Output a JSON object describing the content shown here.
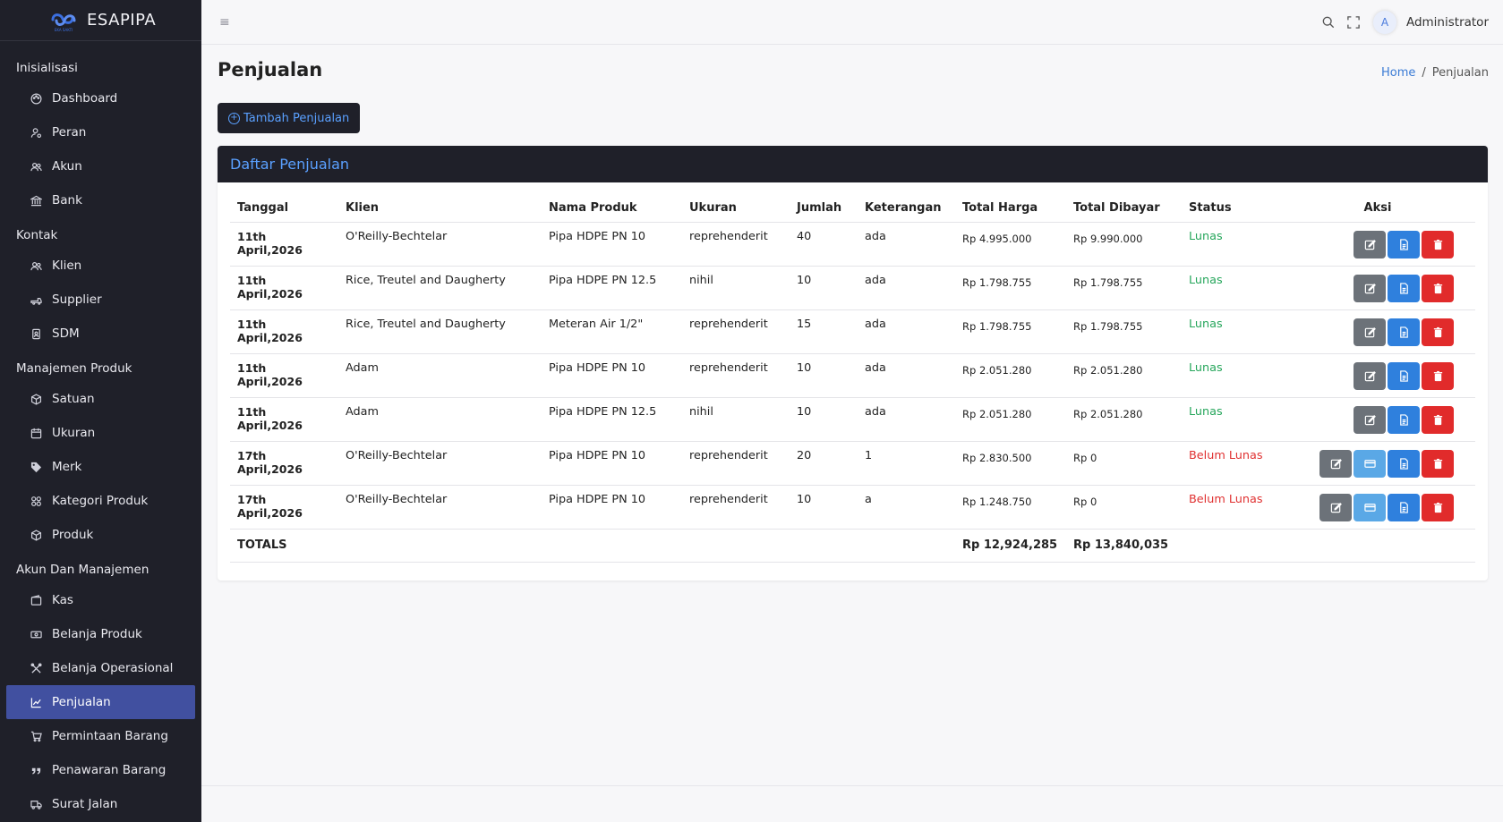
{
  "brand": {
    "name": "ESAPIPA",
    "logo_text": "EKA SAKTI"
  },
  "sidebar": {
    "sections": [
      {
        "title": "Inisialisasi",
        "items": [
          {
            "label": "Dashboard",
            "icon": "palette-icon"
          },
          {
            "label": "Peran",
            "icon": "user-role-icon"
          },
          {
            "label": "Akun",
            "icon": "users-icon"
          },
          {
            "label": "Bank",
            "icon": "bank-icon"
          }
        ]
      },
      {
        "title": "Kontak",
        "items": [
          {
            "label": "Klien",
            "icon": "users-icon"
          },
          {
            "label": "Supplier",
            "icon": "truck-arrow-icon"
          },
          {
            "label": "SDM",
            "icon": "id-badge-icon"
          }
        ]
      },
      {
        "title": "Manajemen Produk",
        "items": [
          {
            "label": "Satuan",
            "icon": "box-icon"
          },
          {
            "label": "Ukuran",
            "icon": "calendar-icon"
          },
          {
            "label": "Merk",
            "icon": "tag-icon"
          },
          {
            "label": "Kategori Produk",
            "icon": "categories-icon"
          },
          {
            "label": "Produk",
            "icon": "box-icon"
          }
        ]
      },
      {
        "title": "Akun Dan Manajemen",
        "items": [
          {
            "label": "Kas",
            "icon": "wallet-icon"
          },
          {
            "label": "Belanja Produk",
            "icon": "cash-icon"
          },
          {
            "label": "Belanja Operasional",
            "icon": "tools-icon"
          },
          {
            "label": "Penjualan",
            "icon": "chart-line-icon",
            "active": true
          },
          {
            "label": "Permintaan Barang",
            "icon": "cart-icon"
          },
          {
            "label": "Penawaran Barang",
            "icon": "quote-icon"
          },
          {
            "label": "Surat Jalan",
            "icon": "truck-icon"
          }
        ]
      }
    ]
  },
  "topbar": {
    "user": "Administrator",
    "avatar_initial": "A"
  },
  "page": {
    "title": "Penjualan",
    "breadcrumb": {
      "home": "Home",
      "separator": "/",
      "current": "Penjualan"
    },
    "add_button": "Tambah Penjualan",
    "card_title": "Daftar Penjualan"
  },
  "table": {
    "headers": {
      "date": "Tanggal",
      "client": "Klien",
      "product": "Nama Produk",
      "size": "Ukuran",
      "qty": "Jumlah",
      "note": "Keterangan",
      "total": "Total Harga",
      "paid": "Total Dibayar",
      "status": "Status",
      "actions": "Aksi"
    },
    "rows": [
      {
        "date": "11th April,2026",
        "client": "O'Reilly-Bechtelar",
        "product": "Pipa HDPE PN 10",
        "size": "reprehenderit",
        "qty": "40",
        "note": "ada",
        "total": "Rp 4.995.000",
        "paid": "Rp 9.990.000",
        "status": "Lunas",
        "paid_flag": true
      },
      {
        "date": "11th April,2026",
        "client": "Rice, Treutel and Daugherty",
        "product": "Pipa HDPE PN 12.5",
        "size": "nihil",
        "qty": "10",
        "note": "ada",
        "total": "Rp 1.798.755",
        "paid": "Rp 1.798.755",
        "status": "Lunas",
        "paid_flag": true
      },
      {
        "date": "11th April,2026",
        "client": "Rice, Treutel and Daugherty",
        "product": "Meteran Air 1/2\"",
        "size": "reprehenderit",
        "qty": "15",
        "note": "ada",
        "total": "Rp 1.798.755",
        "paid": "Rp 1.798.755",
        "status": "Lunas",
        "paid_flag": true
      },
      {
        "date": "11th April,2026",
        "client": "Adam",
        "product": "Pipa HDPE PN 10",
        "size": "reprehenderit",
        "qty": "10",
        "note": "ada",
        "total": "Rp 2.051.280",
        "paid": "Rp 2.051.280",
        "status": "Lunas",
        "paid_flag": true
      },
      {
        "date": "11th April,2026",
        "client": "Adam",
        "product": "Pipa HDPE PN 12.5",
        "size": "nihil",
        "qty": "10",
        "note": "ada",
        "total": "Rp 2.051.280",
        "paid": "Rp 2.051.280",
        "status": "Lunas",
        "paid_flag": true
      },
      {
        "date": "17th April,2026",
        "client": "O'Reilly-Bechtelar",
        "product": "Pipa HDPE PN 10",
        "size": "reprehenderit",
        "qty": "20",
        "note": "1",
        "total": "Rp 2.830.500",
        "paid": "Rp 0",
        "status": "Belum Lunas",
        "paid_flag": false
      },
      {
        "date": "17th April,2026",
        "client": "O'Reilly-Bechtelar",
        "product": "Pipa HDPE PN 10",
        "size": "reprehenderit",
        "qty": "10",
        "note": "a",
        "total": "Rp 1.248.750",
        "paid": "Rp 0",
        "status": "Belum Lunas",
        "paid_flag": false
      }
    ],
    "totals": {
      "label": "TOTALS",
      "total": "Rp 12,924,285",
      "paid": "Rp 13,840,035"
    }
  },
  "colors": {
    "sidebar_bg": "#1f2029",
    "active_item": "#4150a0",
    "accent_blue": "#5aa0ff",
    "status_paid": "#26a65b",
    "status_unpaid": "#e03131"
  }
}
